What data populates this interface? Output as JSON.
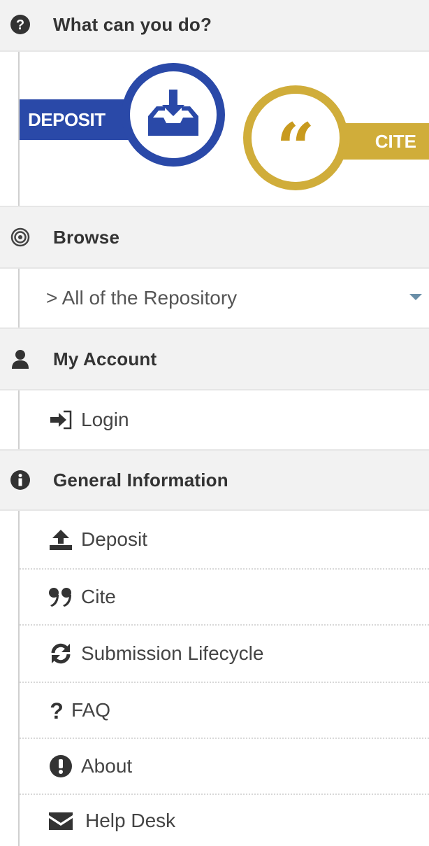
{
  "sections": {
    "what_can_you_do": {
      "title": "What can you do?",
      "deposit_label": "DEPOSIT",
      "cite_label": "CITE"
    },
    "browse": {
      "title": "Browse",
      "scope_label": "> All of the Repository"
    },
    "my_account": {
      "title": "My Account",
      "items": [
        {
          "label": "Login",
          "icon": "login-icon"
        }
      ]
    },
    "general_information": {
      "title": "General Information",
      "items": [
        {
          "label": "Deposit",
          "icon": "upload-icon"
        },
        {
          "label": "Cite",
          "icon": "quote-icon"
        },
        {
          "label": "Submission Lifecycle",
          "icon": "refresh-icon"
        },
        {
          "label": "FAQ",
          "icon": "question-icon"
        },
        {
          "label": "About",
          "icon": "exclamation-icon"
        },
        {
          "label": "Help Desk",
          "icon": "envelope-icon"
        }
      ]
    }
  },
  "colors": {
    "deposit_blue": "#2a49a8",
    "cite_gold": "#d0ad3a",
    "header_bg": "#f2f2f2",
    "text": "#444444"
  }
}
